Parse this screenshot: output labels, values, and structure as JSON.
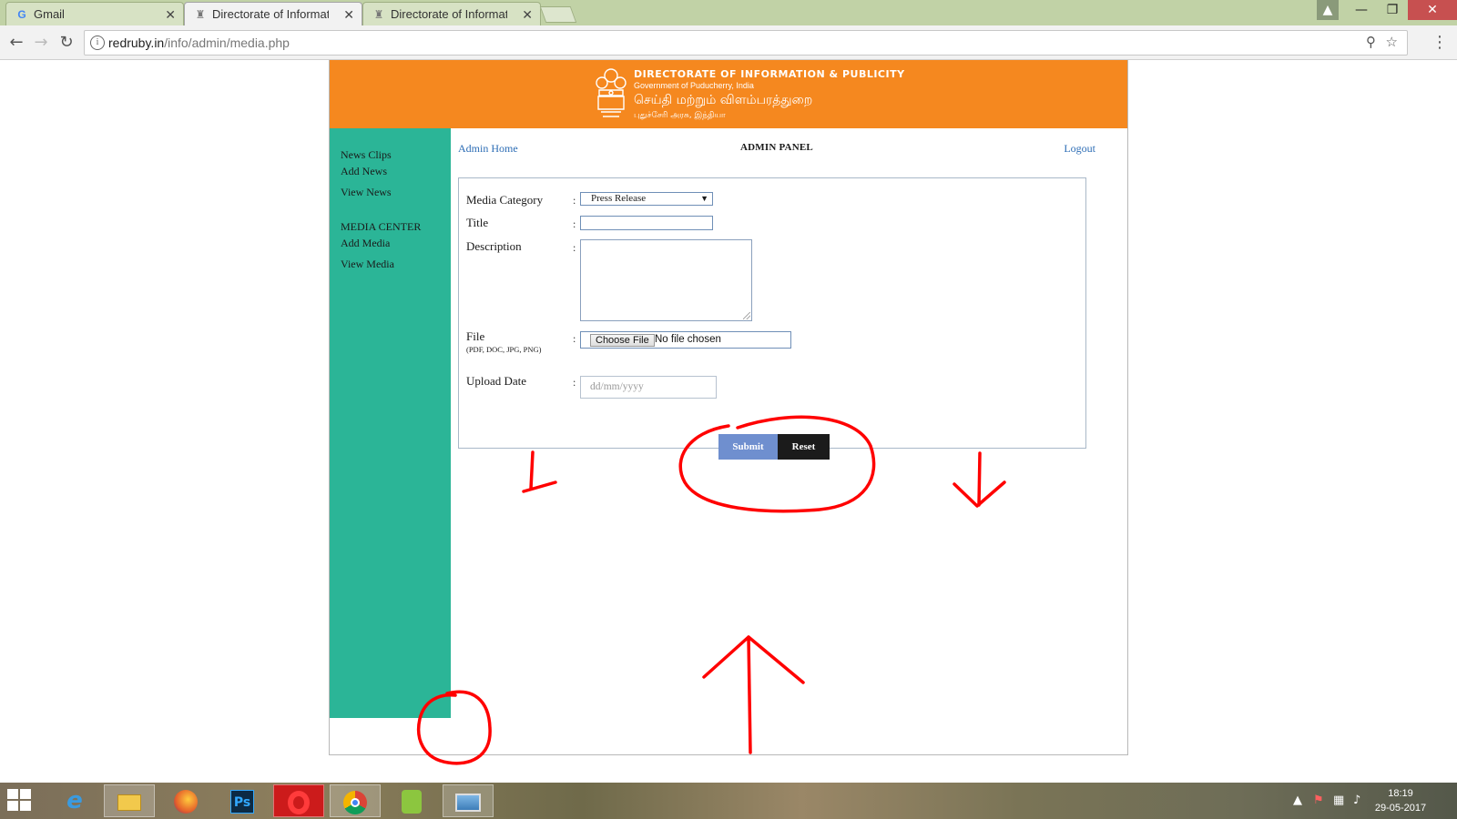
{
  "browser": {
    "tabs": [
      {
        "title": "Gmail",
        "icon": "google-icon"
      },
      {
        "title": "Directorate of Informatic",
        "icon": "emblem-icon",
        "active": true
      },
      {
        "title": "Directorate of Informatic",
        "icon": "emblem-icon"
      }
    ],
    "url_host": "redruby.in",
    "url_path": "/info/admin/media.php"
  },
  "header": {
    "title_en": "DIRECTORATE OF INFORMATION & PUBLICITY",
    "subtitle_en": "Government of Puducherry, India",
    "title_ta": "செய்தி மற்றும் விளம்பரத்துறை",
    "subtitle_ta": "புதுச்சேரி அரசு, இந்தியா"
  },
  "sidebar": {
    "news_heading": "News Clips",
    "news_items": [
      "Add News",
      "View News"
    ],
    "media_heading": "MEDIA CENTER",
    "media_items": [
      "Add Media",
      "View Media"
    ]
  },
  "topbar": {
    "admin_home": "Admin Home",
    "panel_title": "ADMIN PANEL",
    "logout": "Logout"
  },
  "form": {
    "category_label": "Media Category",
    "category_value": "Press Release",
    "title_label": "Title",
    "title_value": "",
    "description_label": "Description",
    "description_value": "",
    "file_label": "File",
    "file_hint": "(PDF, DOC, JPG, PNG)",
    "file_button": "Choose File",
    "file_status": "No file chosen",
    "date_label": "Upload Date",
    "date_placeholder": "dd/mm/yyyy",
    "colon": ":",
    "submit": "Submit",
    "reset": "Reset"
  },
  "colors": {
    "header_orange": "#f5881f",
    "sidebar_green": "#2bb597",
    "submit_blue": "#6f8fcf",
    "reset_black": "#1b1b1b",
    "annotation_red": "#ff0000",
    "link_blue": "#2d6db5"
  },
  "taskbar": {
    "apps": [
      "start-icon",
      "internet-explorer-icon",
      "file-explorer-icon",
      "firefox-icon",
      "photoshop-icon",
      "opera-icon",
      "chrome-icon",
      "app-icon",
      "photos-icon"
    ],
    "photoshop_label": "Ps",
    "time": "18:19",
    "date": "29-05-2017"
  }
}
